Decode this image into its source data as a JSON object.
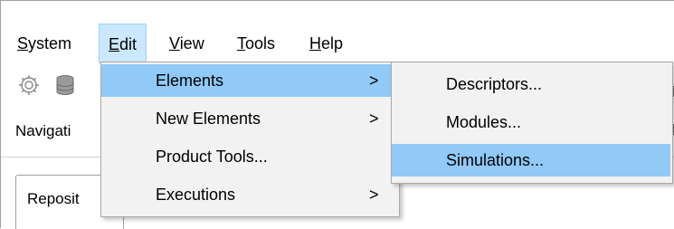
{
  "menubar": {
    "items": [
      {
        "label": "System",
        "mnemonic": "S",
        "rest": "ystem"
      },
      {
        "label": "Edit",
        "mnemonic": "E",
        "rest": "dit"
      },
      {
        "label": "View",
        "mnemonic": "V",
        "rest": "iew"
      },
      {
        "label": "Tools",
        "mnemonic": "T",
        "rest": "ools"
      },
      {
        "label": "Help",
        "mnemonic": "H",
        "rest": "elp"
      }
    ]
  },
  "toolbar": {
    "icons": [
      "gear-icon",
      "database-icon"
    ]
  },
  "navigation": {
    "title": "Navigati",
    "tab_label": "Reposit"
  },
  "edit_menu": {
    "items": [
      {
        "label": "Elements",
        "submenu": true,
        "arrow": ">"
      },
      {
        "label": "New Elements",
        "submenu": true,
        "arrow": ">"
      },
      {
        "label": "Product Tools...",
        "submenu": false,
        "arrow": ""
      },
      {
        "label": "Executions",
        "submenu": true,
        "arrow": ">"
      }
    ]
  },
  "elements_submenu": {
    "items": [
      {
        "label": "Descriptors..."
      },
      {
        "label": "Modules..."
      },
      {
        "label": "Simulations..."
      }
    ]
  },
  "colors": {
    "menu_active_bg": "#cce8ff",
    "dropdown_bg": "#f2f2f2",
    "highlight_bg": "#91c9f7"
  }
}
